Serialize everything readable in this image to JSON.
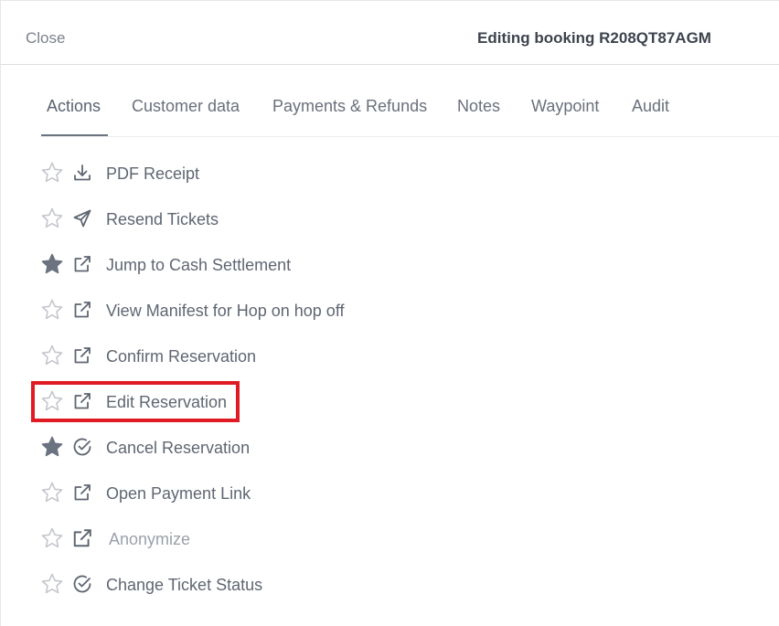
{
  "header": {
    "close_label": "Close",
    "title": "Editing booking R208QT87AGM"
  },
  "tabs": [
    {
      "label": "Actions",
      "active": true
    },
    {
      "label": "Customer data",
      "active": false
    },
    {
      "label": "Payments & Refunds",
      "active": false
    },
    {
      "label": "Notes",
      "active": false
    },
    {
      "label": "Waypoint",
      "active": false
    },
    {
      "label": "Audit",
      "active": false
    }
  ],
  "actions": [
    {
      "label": "PDF Receipt",
      "icon": "download-icon",
      "starred": false,
      "enabled": true
    },
    {
      "label": "Resend Tickets",
      "icon": "send-icon",
      "starred": false,
      "enabled": true
    },
    {
      "label": "Jump to Cash Settlement",
      "icon": "external-link-icon",
      "starred": true,
      "enabled": true
    },
    {
      "label": "View Manifest for Hop on hop off",
      "icon": "external-link-icon",
      "starred": false,
      "enabled": true
    },
    {
      "label": "Confirm Reservation",
      "icon": "external-link-icon",
      "starred": false,
      "enabled": true
    },
    {
      "label": "Edit Reservation",
      "icon": "external-link-icon",
      "starred": false,
      "enabled": true,
      "highlighted": true
    },
    {
      "label": "Cancel Reservation",
      "icon": "check-circle-icon",
      "starred": true,
      "enabled": true
    },
    {
      "label": "Open Payment Link",
      "icon": "external-link-icon",
      "starred": false,
      "enabled": true
    },
    {
      "label": "Anonymize",
      "icon": "external-link-icon",
      "starred": false,
      "enabled": false
    },
    {
      "label": "Change Ticket Status",
      "icon": "check-circle-icon",
      "starred": false,
      "enabled": true
    }
  ],
  "colors": {
    "text": "#5f6672",
    "muted_text": "#9aa0aa",
    "star_filled": "#6b7280",
    "star_outline": "#c4c7cd",
    "highlight": "#e01b24"
  }
}
